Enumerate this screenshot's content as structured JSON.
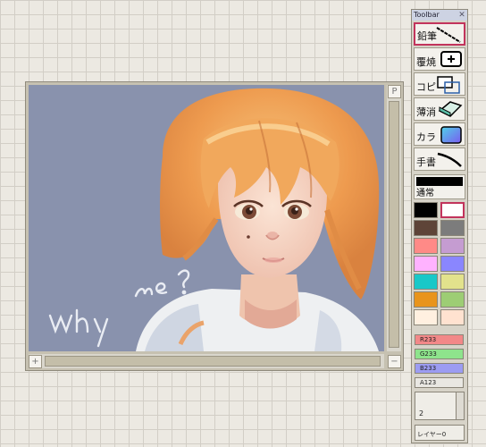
{
  "toolbar": {
    "title": "Toolbar",
    "close_glyph": "✕",
    "tools": [
      {
        "label": "鉛筆",
        "icon": "pencil-line-icon",
        "active": true
      },
      {
        "label": "覆焼",
        "icon": "plus-box-icon",
        "active": false
      },
      {
        "label": "コピ",
        "icon": "copy-rect-icon",
        "active": false
      },
      {
        "label": "薄消",
        "icon": "eraser-icon",
        "active": false
      },
      {
        "label": "カラ",
        "icon": "gradient-icon",
        "active": false
      },
      {
        "label": "手書",
        "icon": "curve-stroke-icon",
        "active": false
      }
    ],
    "mode_label": "通常",
    "swatches": [
      "#000000",
      "#ffffff",
      "#5e4438",
      "#7c7c7c",
      "#ff8a87",
      "#c59cd1",
      "#ffb2ff",
      "#8a86fe",
      "#19c8c8",
      "#e2e28c",
      "#e8941c",
      "#9dcd74",
      "#fff0e0",
      "#ffe2d0"
    ],
    "sliders": [
      {
        "label": "R233",
        "color": "#f28888"
      },
      {
        "label": "G233",
        "color": "#8ee48c"
      },
      {
        "label": "B233",
        "color": "#9c9cf2"
      },
      {
        "label": "A123",
        "color": "#e9e7e2"
      }
    ],
    "brush_size": "2",
    "layer_label": "レイヤー0"
  },
  "canvas": {
    "corner_top_right": "P",
    "corner_bottom_left": "+",
    "corner_bottom_right": "−",
    "handwriting": "why me ?"
  }
}
